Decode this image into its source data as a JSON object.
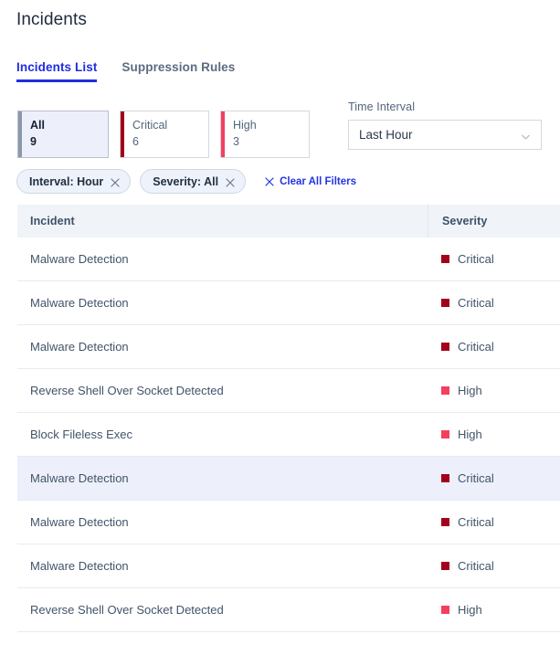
{
  "page": {
    "title": "Incidents"
  },
  "tabs": [
    {
      "label": "Incidents List",
      "active": true
    },
    {
      "label": "Suppression Rules",
      "active": false
    }
  ],
  "stat_cards": [
    {
      "label": "All",
      "value": "9",
      "selected": true,
      "accent": "#8c98a8"
    },
    {
      "label": "Critical",
      "value": "6",
      "selected": false,
      "accent": "#a3001b"
    },
    {
      "label": "High",
      "value": "3",
      "selected": false,
      "accent": "#f43f5e"
    }
  ],
  "time_interval": {
    "label": "Time Interval",
    "value": "Last Hour",
    "icon": "chevron-down-icon"
  },
  "filters": {
    "chips": [
      {
        "label": "Interval: Hour",
        "remove_icon": "close-icon"
      },
      {
        "label": "Severity: All",
        "remove_icon": "close-icon"
      }
    ],
    "clear_all": {
      "label": "Clear All Filters",
      "icon": "close-icon"
    }
  },
  "table": {
    "columns": [
      "Incident",
      "Severity"
    ],
    "rows": [
      {
        "incident": "Malware Detection",
        "severity": "Critical",
        "color": "#a3001b",
        "highlighted": false
      },
      {
        "incident": "Malware Detection",
        "severity": "Critical",
        "color": "#a3001b",
        "highlighted": false
      },
      {
        "incident": "Malware Detection",
        "severity": "Critical",
        "color": "#a3001b",
        "highlighted": false
      },
      {
        "incident": "Reverse Shell Over Socket Detected",
        "severity": "High",
        "color": "#f43f5e",
        "highlighted": false
      },
      {
        "incident": "Block Fileless Exec",
        "severity": "High",
        "color": "#f43f5e",
        "highlighted": false
      },
      {
        "incident": "Malware Detection",
        "severity": "Critical",
        "color": "#a3001b",
        "highlighted": true
      },
      {
        "incident": "Malware Detection",
        "severity": "Critical",
        "color": "#a3001b",
        "highlighted": false
      },
      {
        "incident": "Malware Detection",
        "severity": "Critical",
        "color": "#a3001b",
        "highlighted": false
      },
      {
        "incident": "Reverse Shell Over Socket Detected",
        "severity": "High",
        "color": "#f43f5e",
        "highlighted": false
      }
    ]
  },
  "colors": {
    "accent_blue": "#1f2ee0",
    "critical": "#a3001b",
    "high": "#f43f5e",
    "header_bg": "#f0f4f8",
    "row_highlight": "#edf0fb",
    "text_slate": "#415469"
  }
}
